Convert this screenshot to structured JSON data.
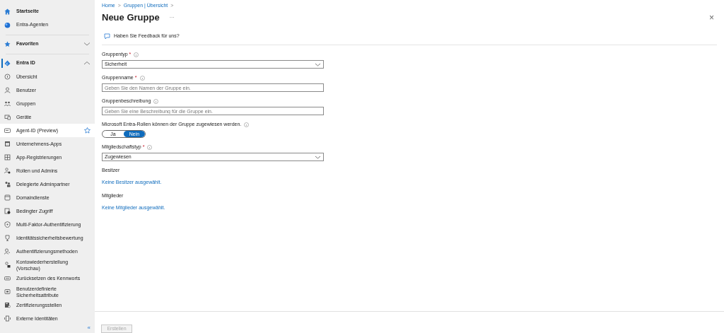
{
  "sidebar": {
    "top": [
      {
        "label": "Startseite"
      },
      {
        "label": "Entra-Agenten"
      }
    ],
    "favorites": {
      "label": "Favoriten",
      "expanded": false
    },
    "section": {
      "label": "Entra ID",
      "expanded": true,
      "current": true
    },
    "items": [
      {
        "label": "Übersicht",
        "selected": false,
        "starred": false
      },
      {
        "label": "Benutzer",
        "selected": false,
        "starred": false
      },
      {
        "label": "Gruppen",
        "selected": false,
        "starred": false
      },
      {
        "label": "Geräte",
        "selected": false,
        "starred": false
      },
      {
        "label": "Agent-ID (Preview)",
        "selected": true,
        "starred": true
      },
      {
        "label": "Unternehmens-Apps",
        "selected": false,
        "starred": false
      },
      {
        "label": "App-Registrierungen",
        "selected": false,
        "starred": false
      },
      {
        "label": "Rollen und Admins",
        "selected": false,
        "starred": false
      },
      {
        "label": "Delegierte Adminpartner",
        "selected": false,
        "starred": false
      },
      {
        "label": "Domaindienste",
        "selected": false,
        "starred": false
      },
      {
        "label": "Bedingter Zugriff",
        "selected": false,
        "starred": false
      },
      {
        "label": "Multi-Faktor-Authentifizierung",
        "selected": false,
        "starred": false
      },
      {
        "label": "Identitätssicherheitsbewertung",
        "selected": false,
        "starred": false
      },
      {
        "label": "Authentifizierungsmethoden",
        "selected": false,
        "starred": false
      },
      {
        "label": "Kontowiederherstellung (Vorschau)",
        "selected": false,
        "starred": false
      },
      {
        "label": "Zurücksetzen des Kennworts",
        "selected": false,
        "starred": false
      },
      {
        "label": "Benutzerdefinierte Sicherheitsattribute",
        "selected": false,
        "starred": false
      },
      {
        "label": "Zertifizierungsstellen",
        "selected": false,
        "starred": false
      },
      {
        "label": "Externe Identitäten",
        "selected": false,
        "starred": false
      }
    ],
    "collapse": "«"
  },
  "breadcrumb": [
    {
      "label": "Home",
      "separator": ">"
    },
    {
      "label": "Gruppen | Übersicht",
      "separator": ">"
    }
  ],
  "title": "Neue Gruppe",
  "title_more": "···",
  "close": "×",
  "feedback": "Haben Sie Feedback für uns?",
  "fields": [
    {
      "kind": "select",
      "label": "Gruppentyp",
      "required_mark": "*",
      "info": true,
      "value": "Sicherheit"
    },
    {
      "kind": "text",
      "label": "Gruppenname",
      "required_mark": "*",
      "info": true,
      "placeholder": "Geben Sie den Namen der Gruppe ein."
    },
    {
      "kind": "text",
      "label": "Gruppenbeschreibung",
      "info": true,
      "placeholder": "Geben Sie eine Beschreibung für die Gruppe ein."
    },
    {
      "kind": "toggle",
      "label": "Microsoft Entra-Rollen können der Gruppe zugewiesen werden.",
      "info": true,
      "options": [
        {
          "label": "Ja",
          "selected": false
        },
        {
          "label": "Nein",
          "selected": true
        }
      ]
    },
    {
      "kind": "select",
      "label": "Mitgliedschaftstyp",
      "required_mark": "*",
      "info": true,
      "value": "Zugewiesen"
    },
    {
      "kind": "link",
      "label": "Besitzer",
      "link": "Keine Besitzer ausgewählt."
    },
    {
      "kind": "link",
      "label": "Mitglieder",
      "link": "Keine Mitglieder ausgewählt."
    }
  ],
  "submit": {
    "label": "Erstellen",
    "disabled": true
  }
}
